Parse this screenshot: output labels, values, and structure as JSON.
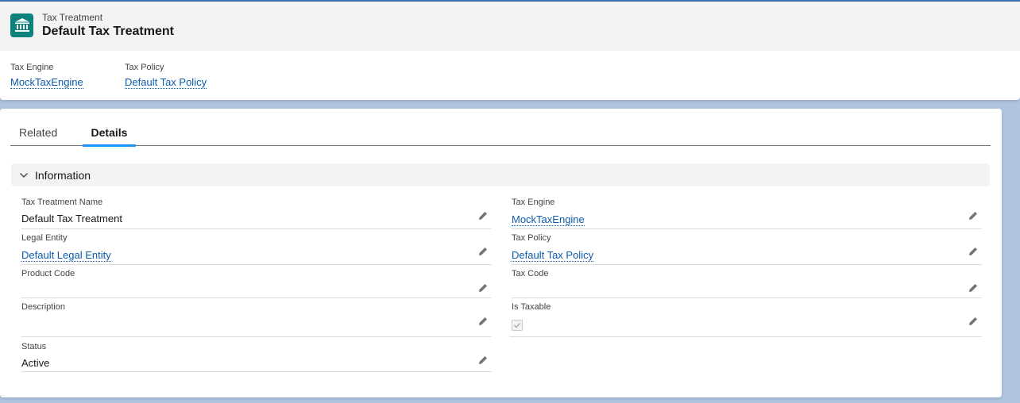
{
  "header": {
    "object_label": "Tax Treatment",
    "record_title": "Default Tax Treatment",
    "highlights": [
      {
        "label": "Tax Engine",
        "value": "MockTaxEngine"
      },
      {
        "label": "Tax Policy",
        "value": "Default Tax Policy"
      }
    ]
  },
  "tabs": [
    {
      "label": "Related",
      "active": false
    },
    {
      "label": "Details",
      "active": true
    }
  ],
  "section": {
    "title": "Information"
  },
  "fields": {
    "tax_treatment_name": {
      "label": "Tax Treatment Name",
      "value": "Default Tax Treatment"
    },
    "legal_entity": {
      "label": "Legal Entity",
      "value": "Default Legal Entity"
    },
    "product_code": {
      "label": "Product Code",
      "value": ""
    },
    "description": {
      "label": "Description",
      "value": ""
    },
    "status": {
      "label": "Status",
      "value": "Active"
    },
    "tax_engine": {
      "label": "Tax Engine",
      "value": "MockTaxEngine"
    },
    "tax_policy": {
      "label": "Tax Policy",
      "value": "Default Tax Policy"
    },
    "tax_code": {
      "label": "Tax Code",
      "value": ""
    },
    "is_taxable": {
      "label": "Is Taxable",
      "checked": true
    }
  },
  "icons": {
    "record": "bank-building-icon",
    "edit": "pencil-icon",
    "section": "chevron-down-icon"
  },
  "colors": {
    "record_icon": "#0b827c",
    "link": "#0b5cab",
    "active_tab": "#1b96ff",
    "background": "#b0c4df"
  }
}
